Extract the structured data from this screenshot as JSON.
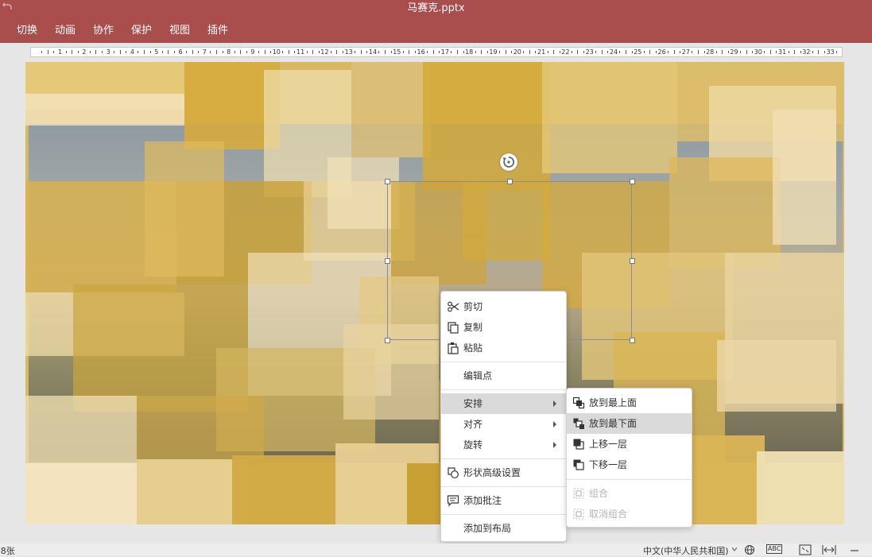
{
  "app": {
    "window_title": "马赛克.pptx"
  },
  "menubar": {
    "items": [
      "切换",
      "动画",
      "协作",
      "保护",
      "视图",
      "插件"
    ]
  },
  "ruler": {
    "labels": [
      "1",
      "2",
      "3",
      "4",
      "5",
      "6",
      "7",
      "8",
      "9",
      "10",
      "11",
      "12",
      "13",
      "14",
      "15",
      "16",
      "17",
      "18",
      "19",
      "20",
      "21",
      "22",
      "23",
      "24",
      "25",
      "26",
      "27",
      "28",
      "29",
      "30",
      "31",
      "32",
      "33"
    ]
  },
  "context_menu": {
    "cut": "剪切",
    "copy": "复制",
    "paste": "粘贴",
    "edit_points": "编辑点",
    "arrange": "安排",
    "align": "对齐",
    "rotate": "旋转",
    "shape_advanced": "形状高级设置",
    "add_comment": "添加批注",
    "add_to_layout": "添加到布局"
  },
  "arrange_submenu": {
    "bring_to_front": "放到最上面",
    "send_to_back": "放到最下面",
    "bring_forward": "上移一层",
    "send_backward": "下移一层",
    "group": "组合",
    "ungroup": "取消组合"
  },
  "statusbar": {
    "slide_count_fragment": ":8张",
    "language": "中文(中华人民共和国)",
    "spell_icon_text": "ABC"
  },
  "colors": {
    "titlebar": "#a94d4d",
    "highlight": "#dadada",
    "tile_gold": "#d4aa3c"
  }
}
